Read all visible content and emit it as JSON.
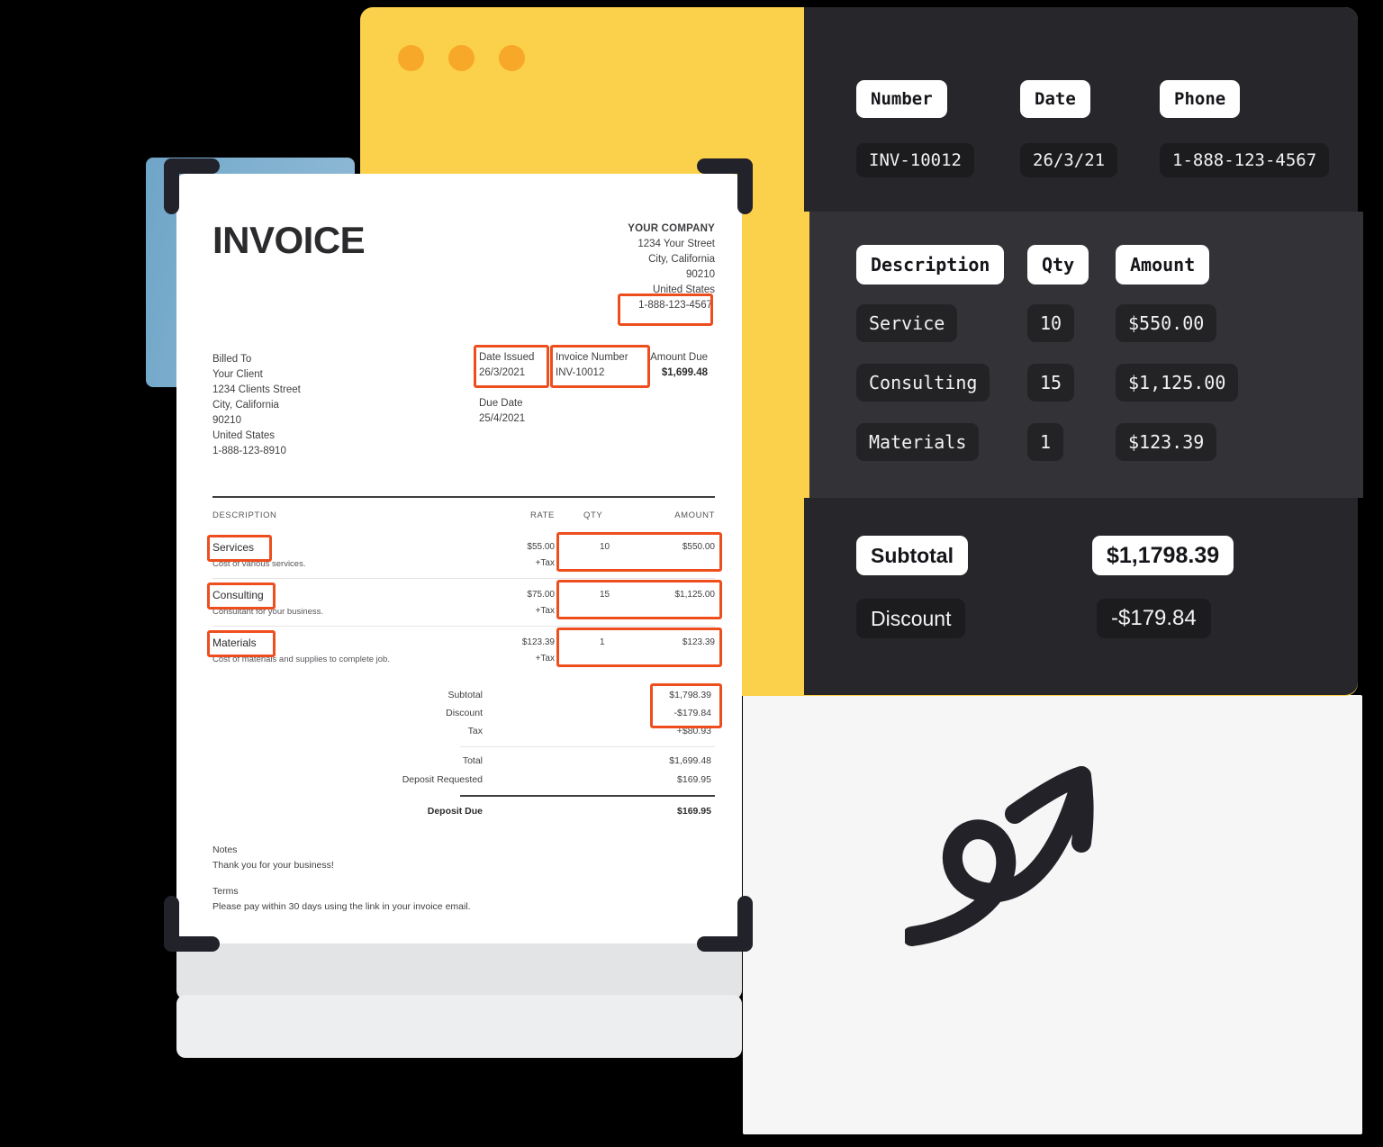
{
  "colors": {
    "accent_orange": "#EE4E1E",
    "yellow_card": "#FBD04A",
    "yellow_dot": "#F7A828",
    "dark_panel_outer": "#27272B",
    "dark_panel_inner": "#333337",
    "pill_label_bg": "#FFFFFF",
    "pill_value_bg": "#1C1C1F",
    "blue_card": "#7FB0CF",
    "page_background": "#F6F6F6",
    "ink": "#2B2B2E"
  },
  "window_card": {
    "name": "yellow-window",
    "traffic_lights": [
      "dot-1",
      "dot-2",
      "dot-3"
    ]
  },
  "extracted_panel": {
    "header_fields": [
      {
        "label": "Number",
        "value": "INV-10012"
      },
      {
        "label": "Date",
        "value": "26/3/21"
      },
      {
        "label": "Phone",
        "value": "1-888-123-4567"
      }
    ],
    "line_items_header": [
      "Description",
      "Qty",
      "Amount"
    ],
    "line_items": [
      {
        "description": "Service",
        "qty": "10",
        "amount": "$550.00"
      },
      {
        "description": "Consulting",
        "qty": "15",
        "amount": "$1,125.00"
      },
      {
        "description": "Materials",
        "qty": "1",
        "amount": "$123.39"
      }
    ],
    "totals": [
      {
        "label": "Subtotal",
        "value": "$1,1798.39"
      },
      {
        "label": "Discount",
        "value": "-$179.84"
      }
    ]
  },
  "invoice": {
    "title": "INVOICE",
    "company": {
      "name": "YOUR COMPANY",
      "address_lines": [
        "1234 Your Street",
        "City, California",
        "90210",
        "United States"
      ],
      "phone": "1-888-123-4567"
    },
    "billed_to": {
      "label": "Billed To",
      "lines": [
        "Your Client",
        "1234 Clients Street",
        "City, California",
        "90210",
        "United States",
        "1-888-123-8910"
      ]
    },
    "date_issued": {
      "label": "Date Issued",
      "value": "26/3/2021"
    },
    "invoice_number": {
      "label": "Invoice Number",
      "value": "INV-10012"
    },
    "amount_due": {
      "label": "Amount Due",
      "value": "$1,699.48"
    },
    "due_date": {
      "label": "Due Date",
      "value": "25/4/2021"
    },
    "table_headers": {
      "description": "DESCRIPTION",
      "rate": "RATE",
      "qty": "QTY",
      "amount": "AMOUNT"
    },
    "line_items": [
      {
        "name": "Services",
        "description": "Cost of various services.",
        "rate": "$55.00",
        "tax": "+Tax",
        "qty": "10",
        "amount": "$550.00"
      },
      {
        "name": "Consulting",
        "description": "Consultant for your business.",
        "rate": "$75.00",
        "tax": "+Tax",
        "qty": "15",
        "amount": "$1,125.00"
      },
      {
        "name": "Materials",
        "description": "Cost of materials and supplies to complete job.",
        "rate": "$123.39",
        "tax": "+Tax",
        "qty": "1",
        "amount": "$123.39"
      }
    ],
    "totals": {
      "subtotal": {
        "label": "Subtotal",
        "value": "$1,798.39"
      },
      "discount": {
        "label": "Discount",
        "value": "-$179.84"
      },
      "tax": {
        "label": "Tax",
        "value": "+$80.93"
      },
      "total": {
        "label": "Total",
        "value": "$1,699.48"
      },
      "deposit_requested": {
        "label": "Deposit Requested",
        "value": "$169.95"
      },
      "deposit_due": {
        "label": "Deposit Due",
        "value": "$169.95"
      }
    },
    "notes": {
      "label": "Notes",
      "text": "Thank you for your business!"
    },
    "terms": {
      "label": "Terms",
      "text": "Please pay within 30 days using the link in your invoice email."
    }
  }
}
